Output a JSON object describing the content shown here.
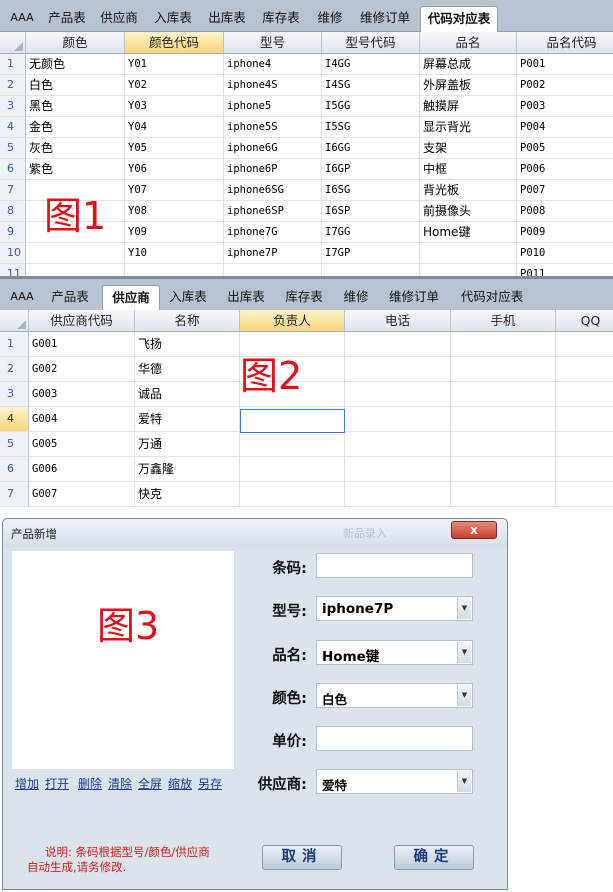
{
  "panel1": {
    "tabs": [
      "AAA",
      "产品表",
      "供应商",
      "入库表",
      "出库表",
      "库存表",
      "维修",
      "维修订单",
      "代码对应表"
    ],
    "active_tab": 8,
    "columns": [
      "颜色",
      "颜色代码",
      "型号",
      "型号代码",
      "品名",
      "品名代码"
    ],
    "selected_column": 1,
    "row_numbers": [
      "1",
      "2",
      "3",
      "4",
      "5",
      "6",
      "7",
      "8",
      "9",
      "10",
      "11"
    ],
    "rows": [
      [
        "无颜色",
        "Y01",
        "iphone4",
        "I4GG",
        "屏幕总成",
        "P001"
      ],
      [
        "白色",
        "Y02",
        "iphone4S",
        "I4SG",
        "外屏盖板",
        "P002"
      ],
      [
        "黑色",
        "Y03",
        "iphone5",
        "I5GG",
        "触摸屏",
        "P003"
      ],
      [
        "金色",
        "Y04",
        "iphone5S",
        "I5SG",
        "显示背光",
        "P004"
      ],
      [
        "灰色",
        "Y05",
        "iphone6G",
        "I6GG",
        "支架",
        "P005"
      ],
      [
        "紫色",
        "Y06",
        "iphone6P",
        "I6GP",
        "中框",
        "P006"
      ],
      [
        "",
        "Y07",
        "iphone6SG",
        "I6SG",
        "背光板",
        "P007"
      ],
      [
        "",
        "Y08",
        "iphone6SP",
        "I6SP",
        "前摄像头",
        "P008"
      ],
      [
        "",
        "Y09",
        "iphone7G",
        "I7GG",
        "Home键",
        "P009"
      ],
      [
        "",
        "Y10",
        "iphone7P",
        "I7GP",
        "",
        "P010"
      ],
      [
        "",
        "",
        "",
        "",
        "",
        "P011"
      ]
    ],
    "label": "图1"
  },
  "panel2": {
    "tabs": [
      "AAA",
      "产品表",
      "供应商",
      "入库表",
      "出库表",
      "库存表",
      "维修",
      "维修订单",
      "代码对应表"
    ],
    "active_tab": 2,
    "columns": [
      "供应商代码",
      "名称",
      "负责人",
      "电话",
      "手机",
      "QQ"
    ],
    "selected_column": 2,
    "row_numbers": [
      "1",
      "2",
      "3",
      "4",
      "5",
      "6",
      "7"
    ],
    "selected_row": 3,
    "rows": [
      [
        "G001",
        "飞扬",
        "",
        "",
        "",
        ""
      ],
      [
        "G002",
        "华德",
        "",
        "",
        "",
        ""
      ],
      [
        "G003",
        "诚品",
        "",
        "",
        "",
        ""
      ],
      [
        "G004",
        "爱特",
        "",
        "",
        "",
        ""
      ],
      [
        "G005",
        "万通",
        "",
        "",
        "",
        ""
      ],
      [
        "G006",
        "万鑫隆",
        "",
        "",
        "",
        ""
      ],
      [
        "G007",
        "快克",
        "",
        "",
        "",
        ""
      ]
    ],
    "label": "图2"
  },
  "dialog": {
    "title": "产品新增",
    "ghost_title": "新品录入",
    "close_glyph": "x",
    "label": "图3",
    "image_links": [
      "增加",
      "打开",
      "删除",
      "清除",
      "全屏",
      "缩放",
      "另存"
    ],
    "fields": {
      "barcode_label": "条码:",
      "barcode_value": "",
      "model_label": "型号:",
      "model_value": "iphone7P",
      "name_label": "品名:",
      "name_value": "Home键",
      "color_label": "颜色:",
      "color_value": "白色",
      "price_label": "单价:",
      "price_value": "",
      "supplier_label": "供应商:",
      "supplier_value": "爱特"
    },
    "note_line1": "说明:    条码根据型号/颜色/供应商",
    "note_line2": "自动生成,请务修改.",
    "cancel_label": "取消",
    "ok_label": "确定",
    "colors": {
      "note": "#d42020",
      "big_label": "#e0101a",
      "link": "#1a3c9c"
    }
  }
}
